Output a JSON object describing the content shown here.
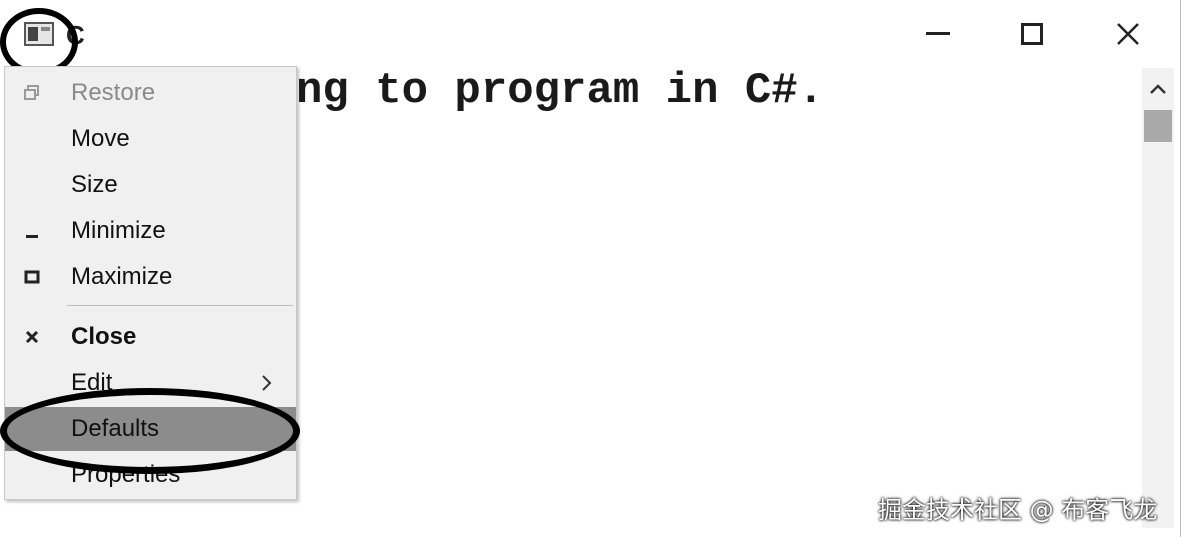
{
  "window": {
    "title_visible": "C",
    "console_line": "ng to program in C#."
  },
  "system_menu": {
    "items": [
      {
        "label": "Restore",
        "icon": "restore-icon",
        "state": "disabled"
      },
      {
        "label": "Move",
        "icon": "",
        "state": "normal"
      },
      {
        "label": "Size",
        "icon": "",
        "state": "normal"
      },
      {
        "label": "Minimize",
        "icon": "minimize-icon",
        "state": "normal"
      },
      {
        "label": "Maximize",
        "icon": "maximize-icon",
        "state": "normal"
      },
      {
        "label": "Close",
        "icon": "close-icon",
        "state": "bold"
      },
      {
        "label": "Edit",
        "icon": "",
        "state": "submenu"
      },
      {
        "label": "Defaults",
        "icon": "",
        "state": "selected"
      },
      {
        "label": "Properties",
        "icon": "",
        "state": "normal"
      }
    ]
  },
  "annotations": {
    "highlight_color": "#000000"
  },
  "watermark": "掘金技术社区 @ 布客飞龙"
}
